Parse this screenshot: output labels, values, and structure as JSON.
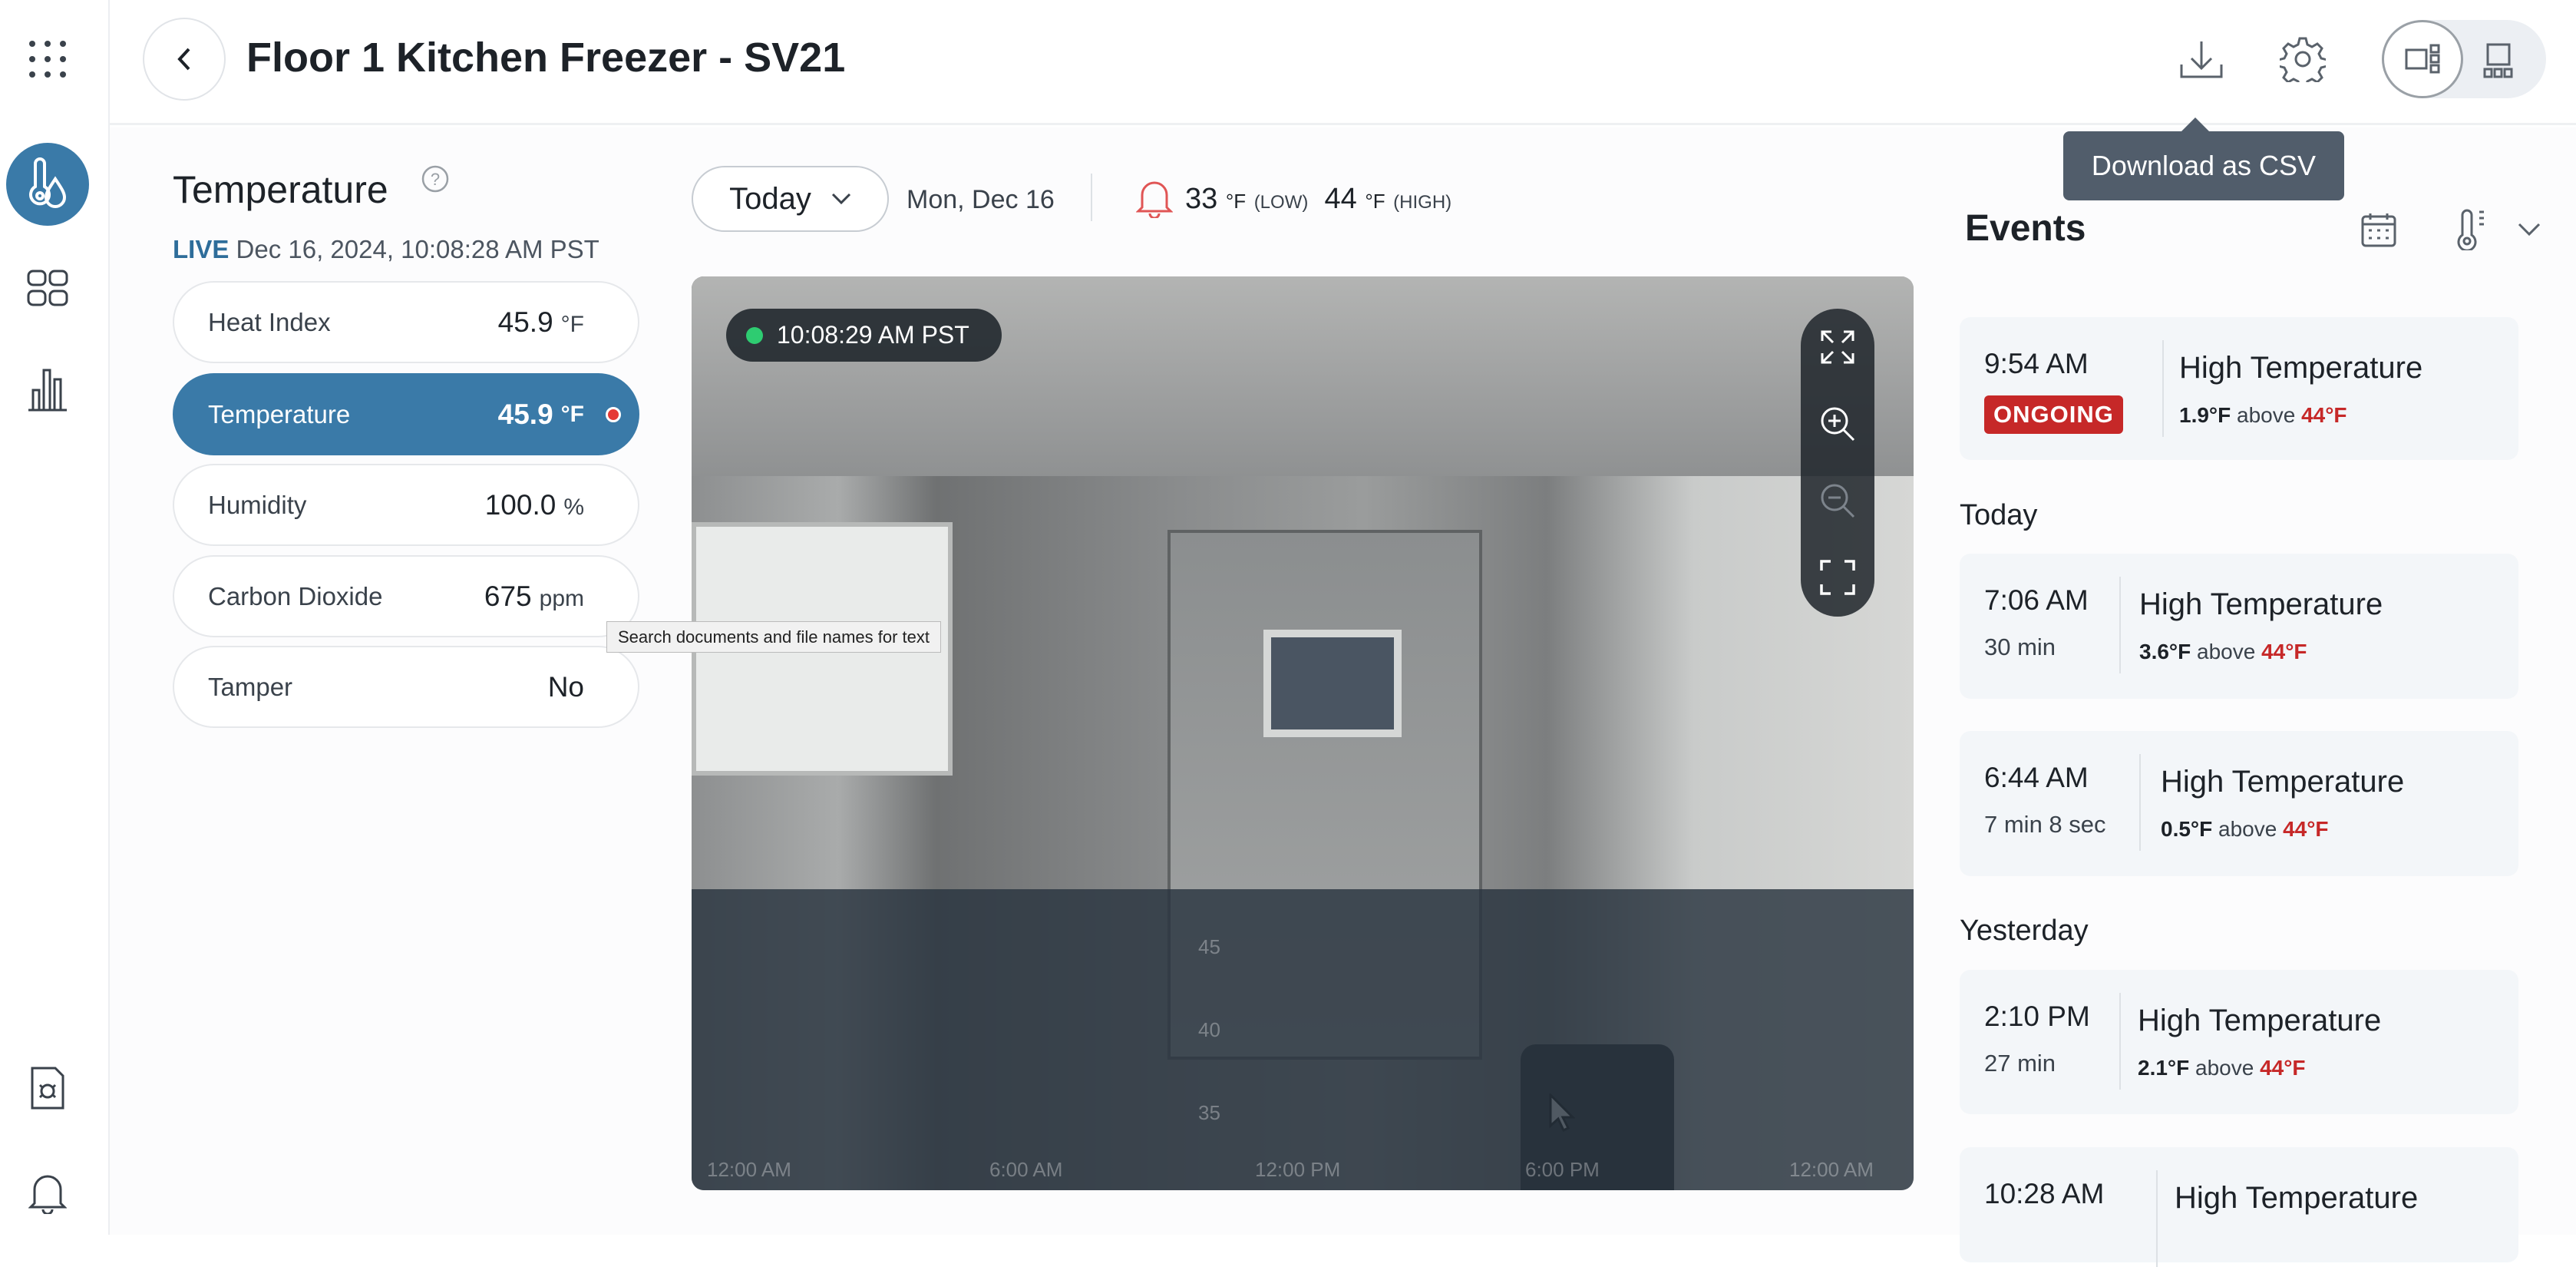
{
  "header": {
    "title": "Floor 1 Kitchen Freezer - SV21",
    "download_tooltip": "Download as CSV"
  },
  "sidebar": {
    "items": [
      "apps-icon",
      "sensor-icon",
      "dashboard-icon",
      "reports-chart-icon",
      "activity-report-icon",
      "notifications-icon"
    ],
    "active": "sensor-icon"
  },
  "panel": {
    "title": "Temperature",
    "live_label": "LIVE",
    "live_time": "Dec 16, 2024, 10:08:28 AM PST",
    "metrics": [
      {
        "label": "Heat Index",
        "value": "45.9",
        "unit": "°F"
      },
      {
        "label": "Temperature",
        "value": "45.9",
        "unit": "°F",
        "selected": true,
        "alert": true
      },
      {
        "label": "Humidity",
        "value": "100.0",
        "unit": "%"
      },
      {
        "label": "Carbon Dioxide",
        "value": "675",
        "unit": "ppm"
      },
      {
        "label": "Tamper",
        "value": "No",
        "unit": ""
      }
    ]
  },
  "toolbar": {
    "range": "Today",
    "date": "Mon, Dec 16",
    "low_value": "33",
    "low_unit": "°F",
    "low_label": "(LOW)",
    "high_value": "44",
    "high_unit": "°F",
    "high_label": "(HIGH)"
  },
  "video": {
    "timestamp": "10:08:29 AM PST",
    "status_color": "#2ecc71",
    "y_ticks": [
      "45",
      "40",
      "35"
    ],
    "x_ticks": [
      "12:00 AM",
      "6:00 AM",
      "12:00 PM",
      "6:00 PM",
      "12:00 AM"
    ]
  },
  "hover_tooltip": "Search documents and file names for text",
  "events": {
    "title": "Events",
    "current": {
      "time": "9:54 AM",
      "badge": "ONGOING",
      "name": "High Temperature",
      "delta": "1.9°F",
      "above": "above",
      "threshold": "44°F"
    },
    "groups": [
      {
        "label": "Today",
        "items": [
          {
            "time": "7:06 AM",
            "duration": "30 min",
            "name": "High Temperature",
            "delta": "3.6°F",
            "above": "above",
            "threshold": "44°F"
          },
          {
            "time": "6:44 AM",
            "duration": "7 min 8 sec",
            "name": "High Temperature",
            "delta": "0.5°F",
            "above": "above",
            "threshold": "44°F"
          }
        ]
      },
      {
        "label": "Yesterday",
        "items": [
          {
            "time": "2:10 PM",
            "duration": "27 min",
            "name": "High Temperature",
            "delta": "2.1°F",
            "above": "above",
            "threshold": "44°F"
          },
          {
            "time": "10:28 AM",
            "name": "High Temperature"
          }
        ]
      }
    ]
  },
  "colors": {
    "accent": "#3a7aa8",
    "alert": "#c62828",
    "badge": "#c62828"
  }
}
